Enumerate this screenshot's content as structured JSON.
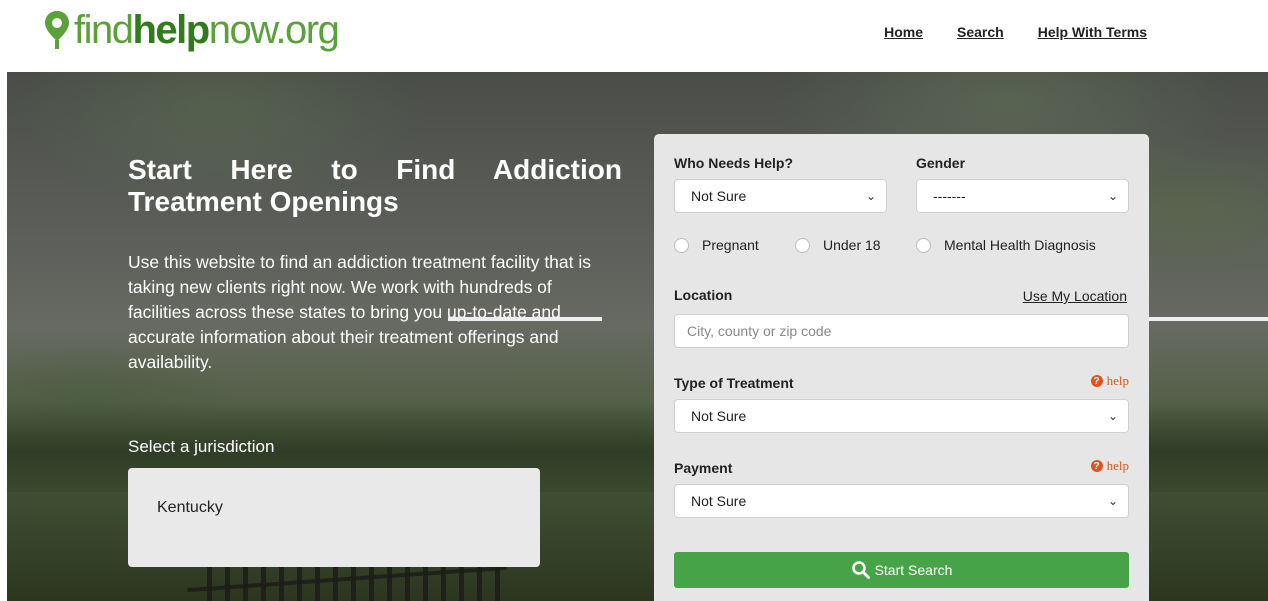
{
  "header": {
    "logo": {
      "part1": "find",
      "part2": "help",
      "part3": "now.org"
    },
    "nav": [
      {
        "label": "Home"
      },
      {
        "label": "Search"
      },
      {
        "label": "Help With Terms"
      }
    ]
  },
  "hero": {
    "title": "Start Here to Find Addiction Treatment Openings",
    "description": "Use this website to find an addiction treatment facility that is taking new clients right now. We work with hundreds of facilities across these states to bring you up-to-date and accurate information about their treatment offerings and availability.",
    "jurisdiction_label": "Select a jurisdiction",
    "jurisdiction_value": "Kentucky"
  },
  "search_form": {
    "who_label": "Who Needs Help?",
    "who_value": "Not Sure",
    "gender_label": "Gender",
    "gender_value": "-------",
    "radios": [
      {
        "label": "Pregnant"
      },
      {
        "label": "Under 18"
      },
      {
        "label": "Mental Health Diagnosis"
      }
    ],
    "location_label": "Location",
    "use_location": "Use My Location",
    "location_placeholder": "City, county or zip code",
    "treatment_label": "Type of Treatment",
    "treatment_help": "help",
    "treatment_value": "Not Sure",
    "payment_label": "Payment",
    "payment_help": "help",
    "payment_value": "Not Sure",
    "submit_label": "Start Search"
  },
  "icons": {
    "logo": "map-pin-icon",
    "select": "chevron-down-icon",
    "help": "question-circle-icon",
    "submit": "search-icon"
  },
  "colors": {
    "brand_green": "#5aa13a",
    "button_green": "#47a348",
    "help_orange": "#e0531d"
  }
}
